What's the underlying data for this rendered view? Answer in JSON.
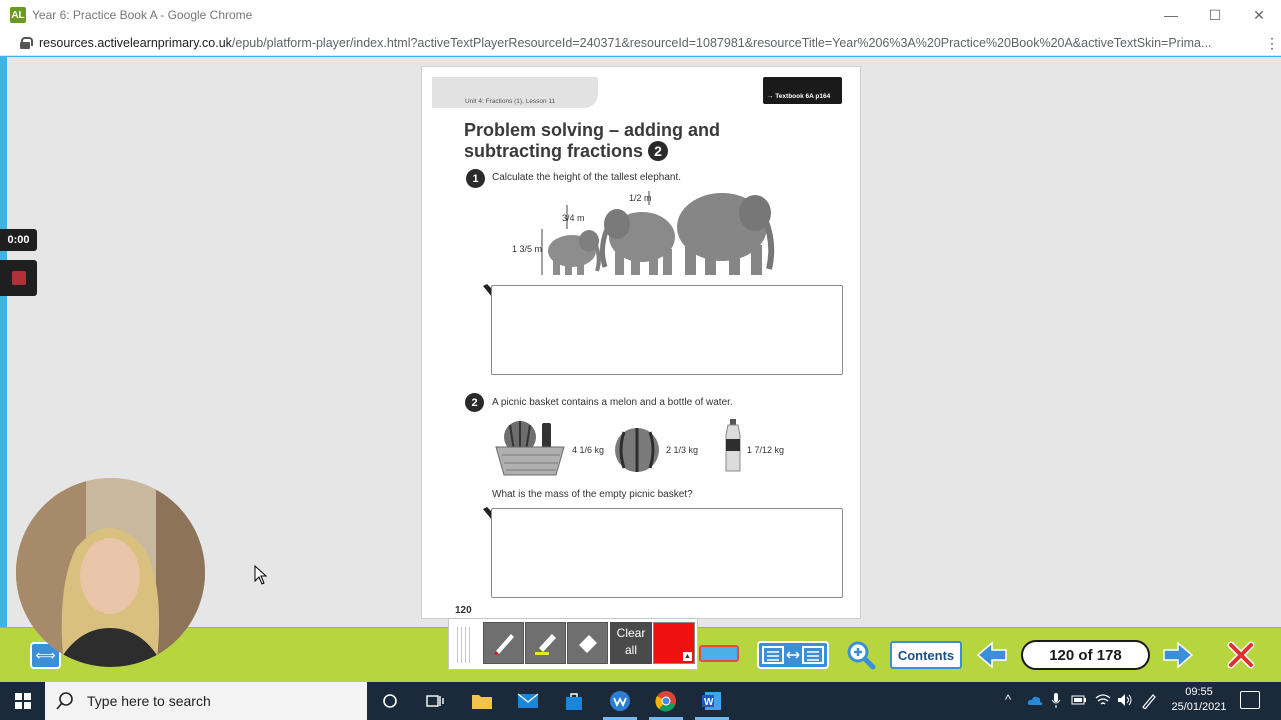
{
  "browser": {
    "app_badge": "AL",
    "title": "Year 6: Practice Book A - Google Chrome",
    "url_host": "resources.activelearnprimary.co.uk",
    "url_path": "/epub/platform-player/index.html?activeTextPlayerResourceId=240371&resourceId=1087981&resourceTitle=Year%206%3A%20Practice%20Book%20A&activeTextSkin=Prima..."
  },
  "recorder": {
    "time": "0:00"
  },
  "page": {
    "unit_label": "Unit 4: Fractions (1), Lesson 11",
    "textbook_ref": "→ Textbook 6A p164",
    "title_line1": "Problem solving – adding and",
    "title_line2": "subtracting fractions",
    "title_number": "2",
    "q1": {
      "number": "1",
      "text": "Calculate the height of the tallest elephant.",
      "m1": "1 3/5 m",
      "m2": "3/4 m",
      "m3": "1/2 m"
    },
    "q2": {
      "number": "2",
      "text": "A picnic basket contains a melon and a bottle of water.",
      "basket_mass": "4 1/6 kg",
      "melon_mass": "2 1/3 kg",
      "bottle_mass": "1 7/12 kg",
      "question": "What is the mass of the empty picnic basket?"
    },
    "page_number": "120"
  },
  "toolbar": {
    "clear_label_1": "Clear",
    "clear_label_2": "all",
    "contents_label": "Contents",
    "page_counter": "120 of 178",
    "pen_color": "#ee1111"
  },
  "taskbar": {
    "search_placeholder": "Type here to search",
    "time": "09:55",
    "date": "25/01/2021"
  }
}
